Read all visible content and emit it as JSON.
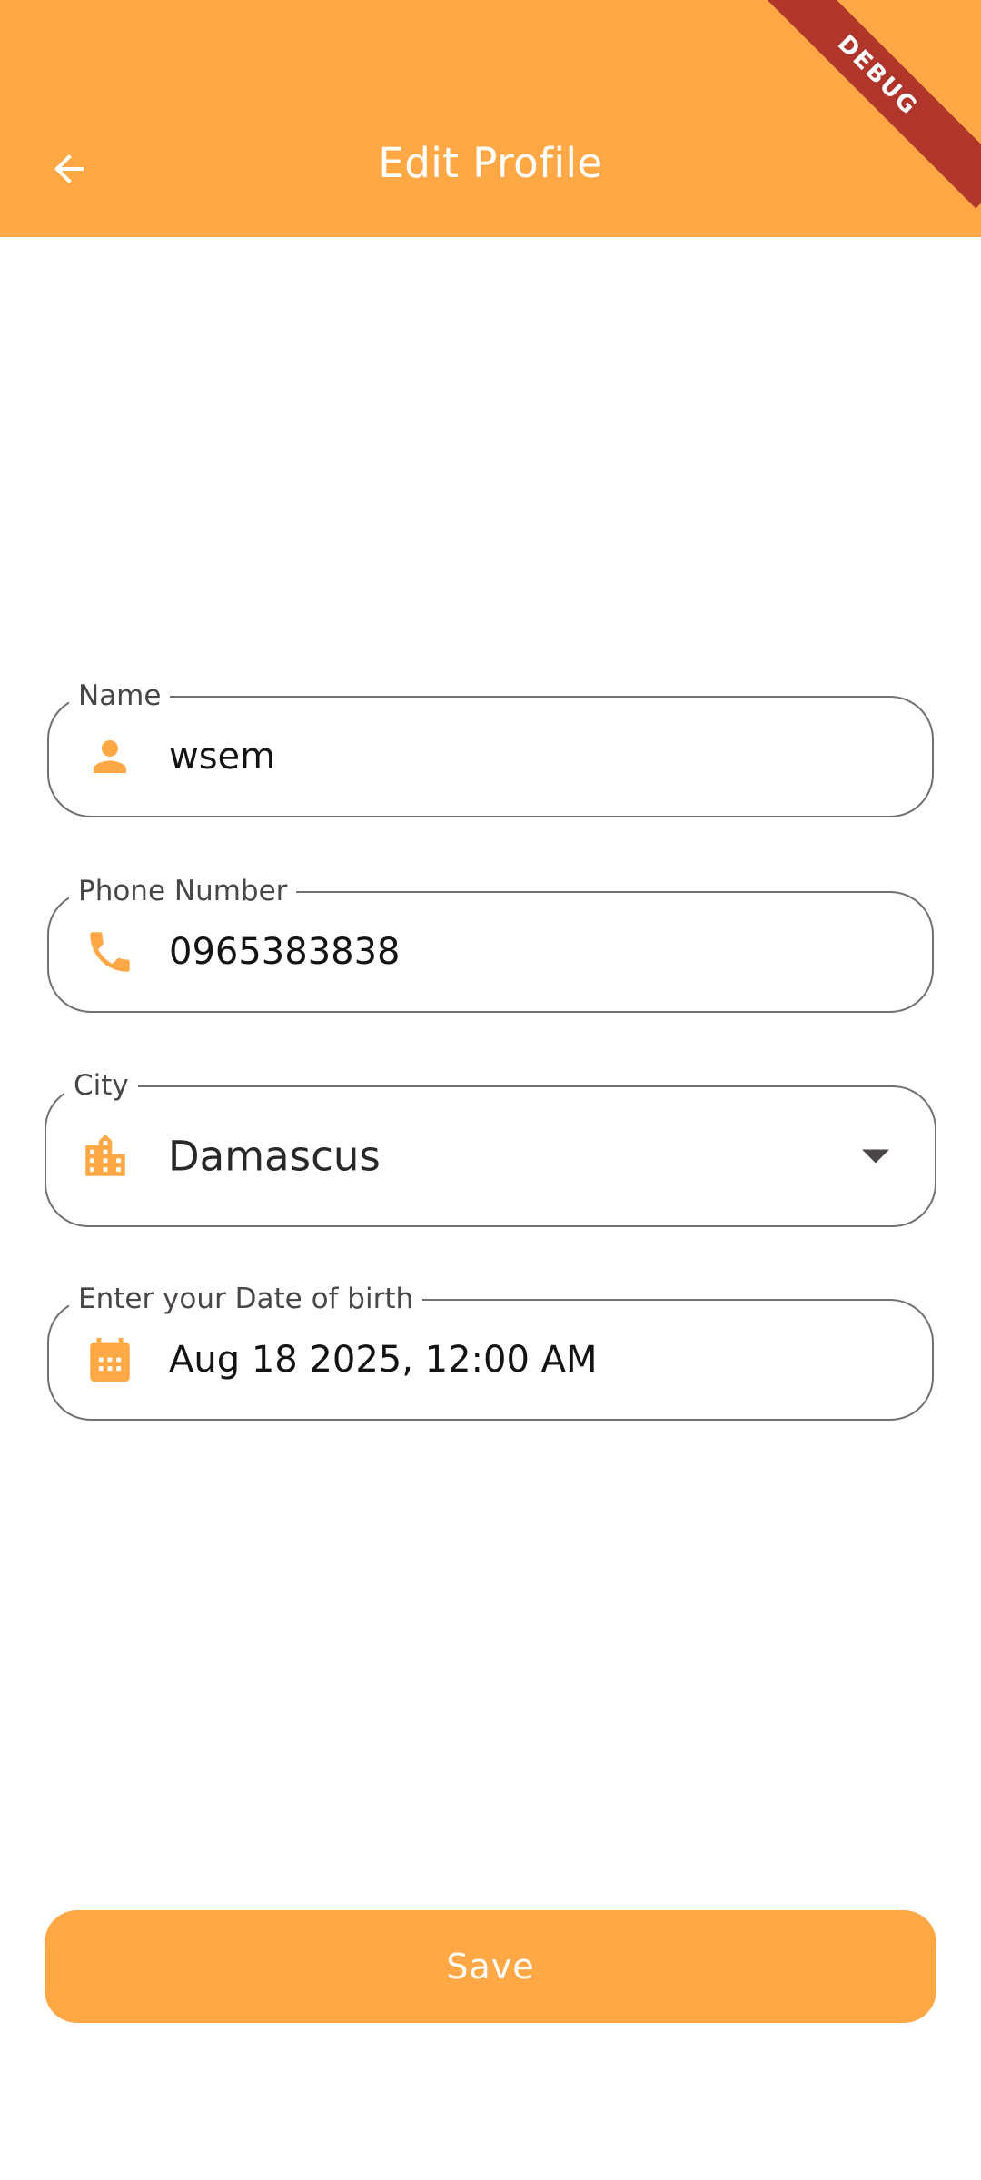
{
  "appbar": {
    "title": "Edit Profile",
    "back_icon": "arrow-back-icon",
    "background": "#FFA845"
  },
  "debug_banner": {
    "label": "DEBUG",
    "color": "#B0352A"
  },
  "form": {
    "name": {
      "label": "Name",
      "value": "wsem",
      "icon": "person-icon"
    },
    "phone": {
      "label": "Phone Number",
      "value": "0965383838",
      "icon": "phone-icon"
    },
    "city": {
      "label": "City",
      "value": "Damascus",
      "icon": "city-icon"
    },
    "dob": {
      "label": "Enter your Date of birth",
      "value": "Aug 18 2025, 12:00 AM",
      "icon": "calendar-icon"
    }
  },
  "save_button": {
    "label": "Save"
  },
  "colors": {
    "accent": "#FFA845",
    "icon": "#FFA845",
    "border": "#75706f"
  }
}
